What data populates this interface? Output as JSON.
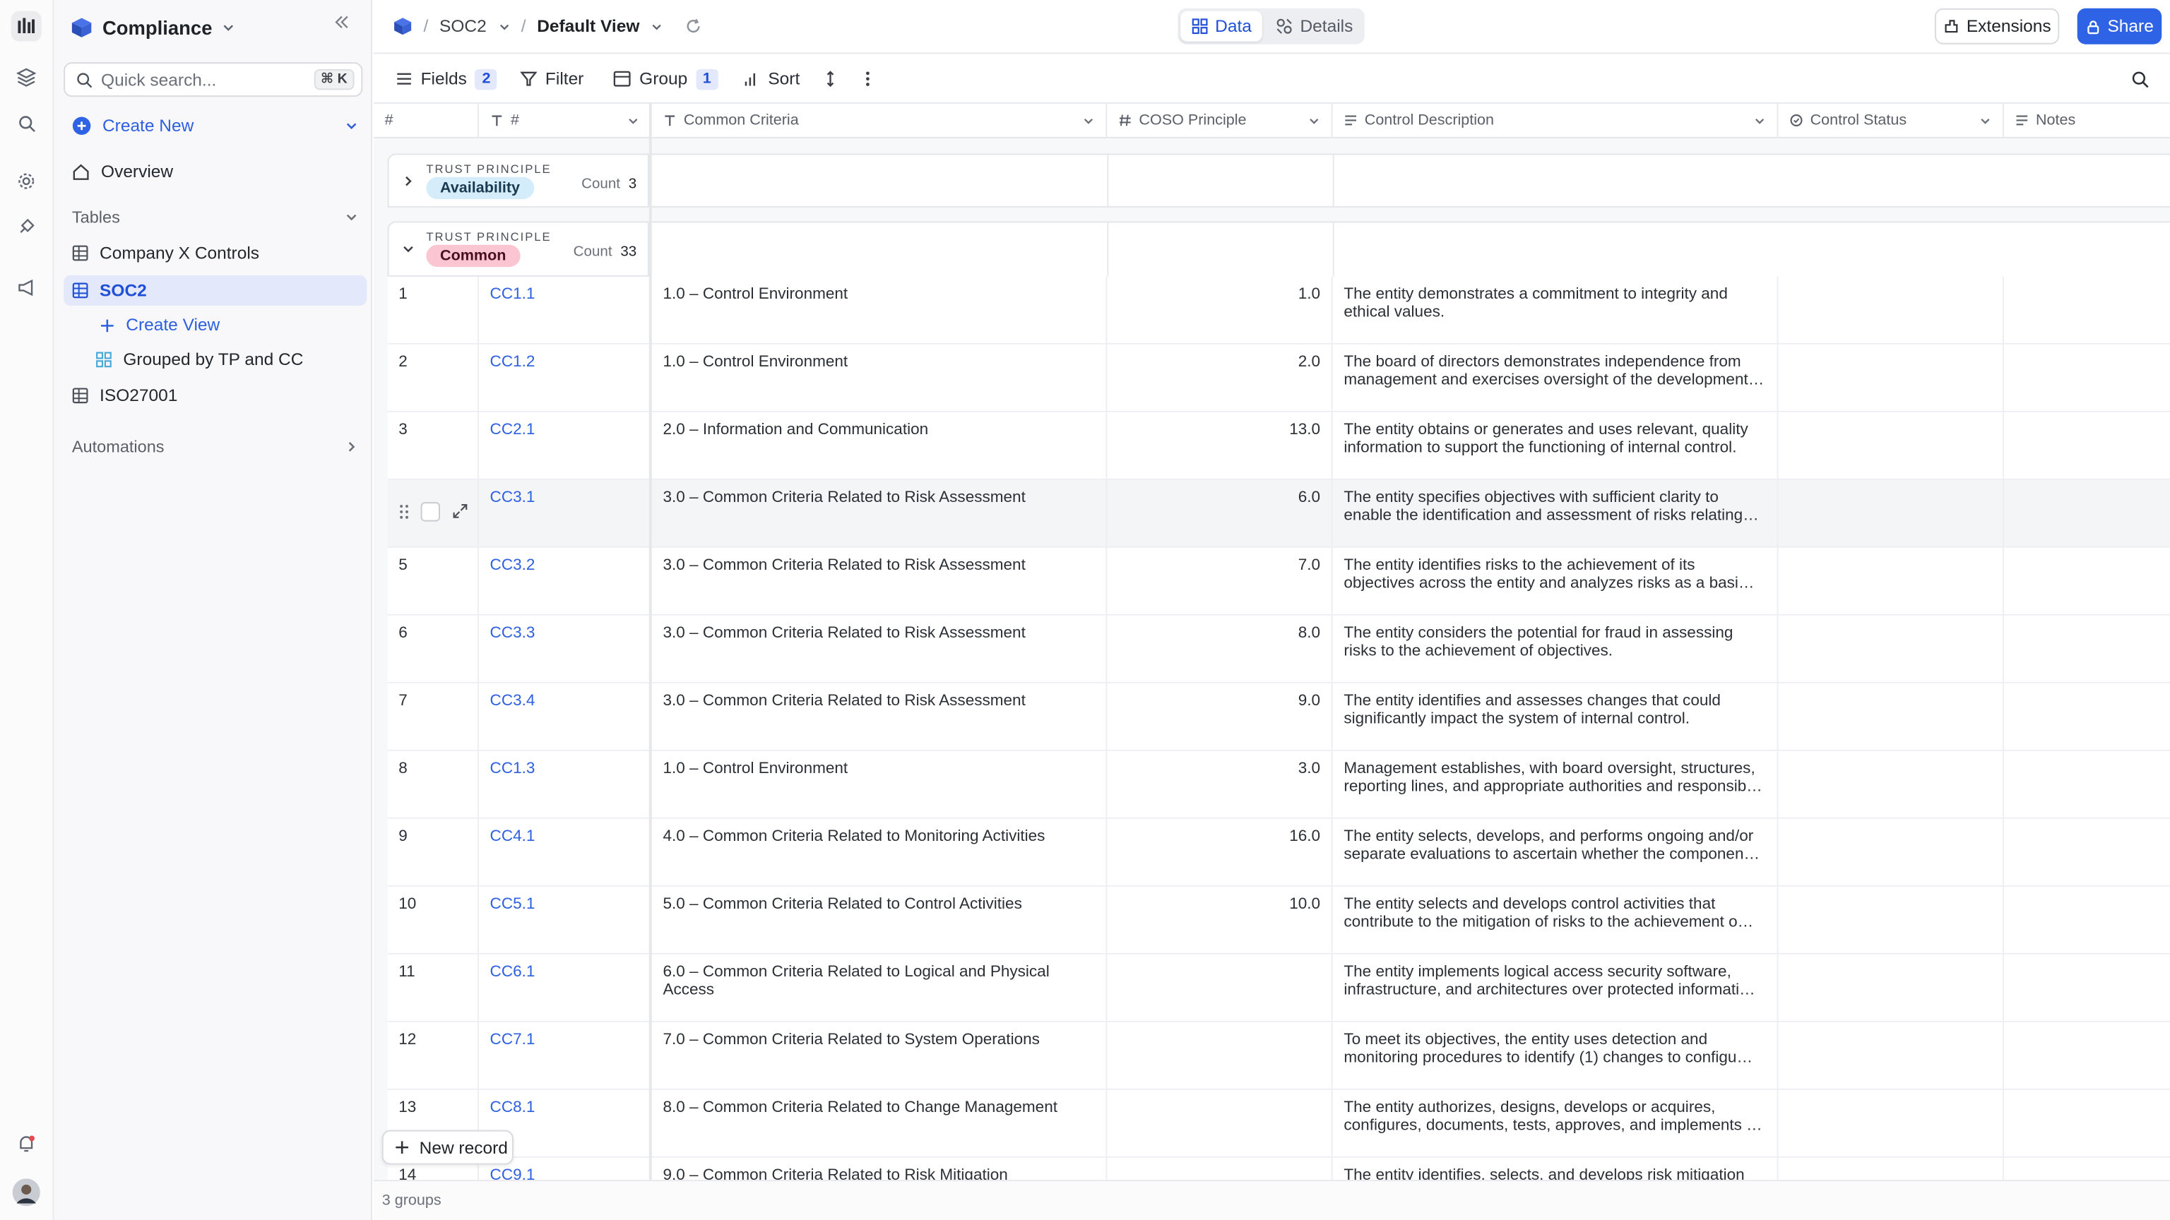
{
  "app": {
    "workspace": "Compliance",
    "search_placeholder": "Quick search...",
    "search_shortcut": "⌘ K"
  },
  "sidebar": {
    "create_new": "Create New",
    "overview": "Overview",
    "tables_label": "Tables",
    "tables": [
      {
        "label": "Company X Controls"
      },
      {
        "label": "SOC2"
      },
      {
        "label": "ISO27001"
      }
    ],
    "views": [
      {
        "label": "Create View"
      },
      {
        "label": "Grouped by TP and CC"
      }
    ],
    "automations": "Automations"
  },
  "topbar": {
    "breadcrumb": [
      "SOC2",
      "Default View"
    ],
    "tabs": [
      "Data",
      "Details"
    ],
    "extensions": "Extensions",
    "share": "Share"
  },
  "toolbar": {
    "fields": "Fields",
    "fields_count": "2",
    "filter": "Filter",
    "group": "Group",
    "group_count": "1",
    "sort": "Sort"
  },
  "columns": [
    "#",
    "#",
    "Common Criteria",
    "COSO Principle",
    "Control Description",
    "Control Status",
    "Notes"
  ],
  "groups": [
    {
      "label": "TRUST PRINCIPLE",
      "value": "Availability",
      "count_label": "Count",
      "count": "3"
    },
    {
      "label": "TRUST PRINCIPLE",
      "value": "Common",
      "count_label": "Count",
      "count": "33"
    }
  ],
  "rows": [
    {
      "n": "1",
      "id": "CC1.1",
      "criteria": "1.0 – Control Environment",
      "coso": "1.0",
      "desc": "The entity demonstrates a commitment to integrity and ethical values."
    },
    {
      "n": "2",
      "id": "CC1.2",
      "criteria": "1.0 – Control Environment",
      "coso": "2.0",
      "desc": "The board of directors demonstrates independence from management and exercises oversight of the development…"
    },
    {
      "n": "3",
      "id": "CC2.1",
      "criteria": "2.0 – Information and Communication",
      "coso": "13.0",
      "desc": "The entity obtains or generates and uses relevant, quality information to support the functioning of internal control."
    },
    {
      "n": "",
      "id": "CC3.1",
      "criteria": "3.0 – Common Criteria Related to Risk Assessment",
      "coso": "6.0",
      "desc": "The entity specifies objectives with sufficient clarity to enable the identification and assessment of risks relating…"
    },
    {
      "n": "5",
      "id": "CC3.2",
      "criteria": "3.0 – Common Criteria Related to Risk Assessment",
      "coso": "7.0",
      "desc": "The entity identifies risks to the achievement of its objectives across the entity and analyzes risks as a basi…"
    },
    {
      "n": "6",
      "id": "CC3.3",
      "criteria": "3.0 – Common Criteria Related to Risk Assessment",
      "coso": "8.0",
      "desc": "The entity considers the potential for fraud in assessing risks to the achievement of objectives."
    },
    {
      "n": "7",
      "id": "CC3.4",
      "criteria": "3.0 – Common Criteria Related to Risk Assessment",
      "coso": "9.0",
      "desc": "The entity identifies and assesses changes that could significantly impact the system of internal control."
    },
    {
      "n": "8",
      "id": "CC1.3",
      "criteria": "1.0 – Control Environment",
      "coso": "3.0",
      "desc": "Management establishes, with board oversight, structures, reporting lines, and appropriate authorities and responsib…"
    },
    {
      "n": "9",
      "id": "CC4.1",
      "criteria": "4.0 – Common Criteria Related to Monitoring Activities",
      "coso": "16.0",
      "desc": "The entity selects, develops, and performs ongoing and/or separate evaluations to ascertain whether the componen…"
    },
    {
      "n": "10",
      "id": "CC5.1",
      "criteria": "5.0 – Common Criteria Related to Control Activities",
      "coso": "10.0",
      "desc": "The entity selects and develops control activities that contribute to the mitigation of risks to the achievement o…"
    },
    {
      "n": "11",
      "id": "CC6.1",
      "criteria": "6.0 – Common Criteria Related to Logical and Physical Access",
      "coso": "",
      "desc": "The entity implements logical access security software, infrastructure, and architectures over protected informati…"
    },
    {
      "n": "12",
      "id": "CC7.1",
      "criteria": "7.0 – Common Criteria Related to System Operations",
      "coso": "",
      "desc": "To meet its objectives, the entity uses detection and monitoring procedures to identify (1) changes to configu…"
    },
    {
      "n": "13",
      "id": "CC8.1",
      "criteria": "8.0 – Common Criteria Related to Change Management",
      "coso": "",
      "desc": "The entity authorizes, designs, develops or acquires, configures, documents, tests, approves, and implements …"
    },
    {
      "n": "14",
      "id": "CC9.1",
      "criteria": "9.0 – Common Criteria Related to Risk Mitigation",
      "coso": "",
      "desc": "The entity identifies, selects, and develops risk mitigation activities for risks arising from potential business disruptions."
    }
  ],
  "new_record": "New record",
  "status": "3 groups"
}
